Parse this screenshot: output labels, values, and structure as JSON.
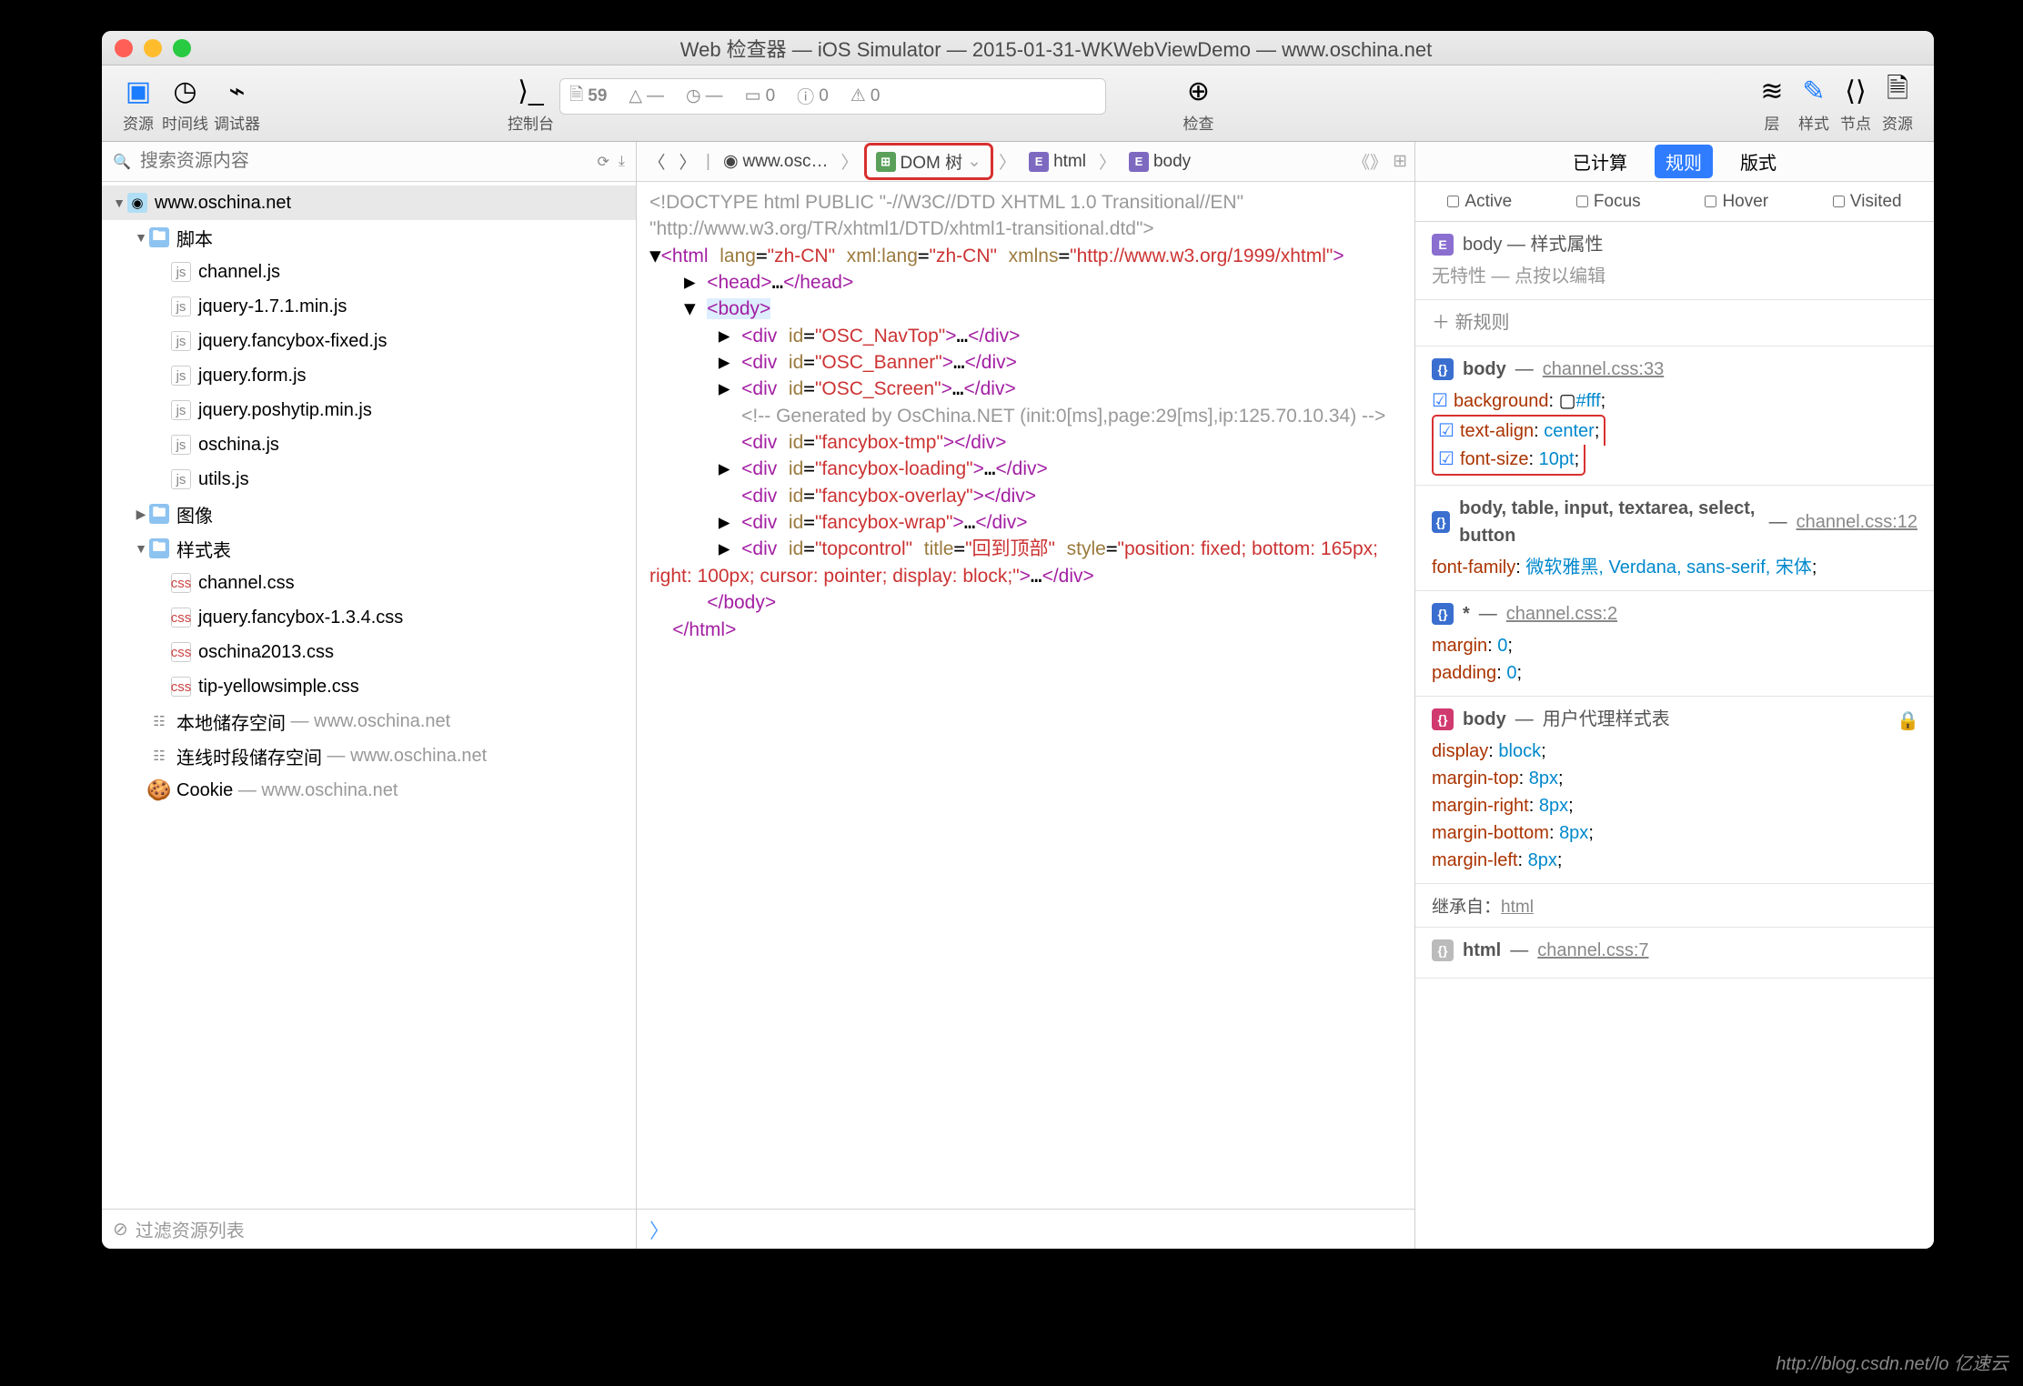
{
  "title": "Web 检查器 — iOS Simulator — 2015-01-31-WKWebViewDemo — www.oschina.net",
  "toolbar": {
    "resources": "资源",
    "timeline": "时间线",
    "debugger": "调试器",
    "console": "控制台",
    "inspect": "检查",
    "layers": "层",
    "styles": "样式",
    "node": "节点",
    "res2": "资源",
    "url_page": "59",
    "ub1": "—",
    "ub2": "—",
    "ub3": "0",
    "ub4": "0",
    "ub5": "0"
  },
  "search_ph": "搜索资源内容",
  "tree": {
    "root": "www.oschina.net",
    "scripts": "脚本",
    "scripts_items": [
      "channel.js",
      "jquery-1.7.1.min.js",
      "jquery.fancybox-fixed.js",
      "jquery.form.js",
      "jquery.poshytip.min.js",
      "oschina.js",
      "utils.js"
    ],
    "images": "图像",
    "styles": "样式表",
    "styles_items": [
      "channel.css",
      "jquery.fancybox-1.3.4.css",
      "oschina2013.css",
      "tip-yellowsimple.css"
    ],
    "local": "本地储存空间",
    "local2": "www.oschina.net",
    "session": "连线时段储存空间",
    "session2": "www.oschina.net",
    "cookie": "Cookie",
    "cookie2": "www.oschina.net"
  },
  "filter_ph": "过滤资源列表",
  "crumbs": {
    "site": "www.osc…",
    "dom": "DOM 树",
    "html": "html",
    "body": "body"
  },
  "dom": {
    "doctype": "<!DOCTYPE html PUBLIC \"-//W3C//DTD XHTML 1.0 Transitional//EN\" \"http://www.w3.org/TR/xhtml1/DTD/xhtml1-transitional.dtd\">",
    "html_open": "<html lang=\"zh-CN\" xml:lang=\"zh-CN\" xmlns=\"http://www.w3.org/1999/xhtml\">",
    "head": "<head>…</head>",
    "body": "<body>",
    "d1": "<div id=\"OSC_NavTop\">…</div>",
    "d2": "<div id=\"OSC_Banner\">…</div>",
    "d3": "<div id=\"OSC_Screen\">…</div>",
    "cmt": "<!-- Generated by OsChina.NET (init:0[ms],page:29[ms],ip:125.70.10.34) -->",
    "d4": "<div id=\"fancybox-tmp\"></div>",
    "d5": "<div id=\"fancybox-loading\">…</div>",
    "d6": "<div id=\"fancybox-overlay\"></div>",
    "d7": "<div id=\"fancybox-wrap\">…</div>",
    "d8a": "<div id=\"topcontrol\" title=\"回到顶部\" style=",
    "d8b": "\"position: fixed; bottom: 165px; right: 100px; cursor: pointer; display: block;\">…</div>",
    "bodyc": "</body>",
    "htmlc": "</html>"
  },
  "rtabs": {
    "computed": "已计算",
    "rules": "规则",
    "layout": "版式"
  },
  "pseudo": {
    "active": "Active",
    "focus": "Focus",
    "hover": "Hover",
    "visited": "Visited"
  },
  "r": {
    "attr_head": "body — 样式属性",
    "attr_sub": "无特性 — 点按以编辑",
    "newrule": "新规则",
    "s1_sel": "body",
    "s1_src": "channel.css:33",
    "s1_p1": "background",
    "s1_v1": "#fff",
    "s1_p2": "text-align",
    "s1_v2": "center",
    "s1_p3": "font-size",
    "s1_v3": "10pt",
    "s2_sel": "body, table, input, textarea, select, button",
    "s2_src": "channel.css:12",
    "s2_p1": "font-family",
    "s2_v1": "微软雅黑, Verdana, sans-serif, 宋体",
    "s3_sel": "*",
    "s3_src": "channel.css:2",
    "s3_p1": "margin",
    "s3_v1": "0",
    "s3_p2": "padding",
    "s3_v2": "0",
    "s4_sel": "body",
    "s4_src": "用户代理样式表",
    "s4_p1": "display",
    "s4_v1": "block",
    "s4_p2": "margin-top",
    "s4_v2": "8px",
    "s4_p3": "margin-right",
    "s4_v3": "8px",
    "s4_p4": "margin-bottom",
    "s4_v4": "8px",
    "s4_p5": "margin-left",
    "s4_v5": "8px",
    "inh": "继承自：",
    "inh_el": "html",
    "s5_sel": "html",
    "s5_src": "channel.css:7"
  },
  "watermark": "http://blog.csdn.net/lo   亿速云"
}
